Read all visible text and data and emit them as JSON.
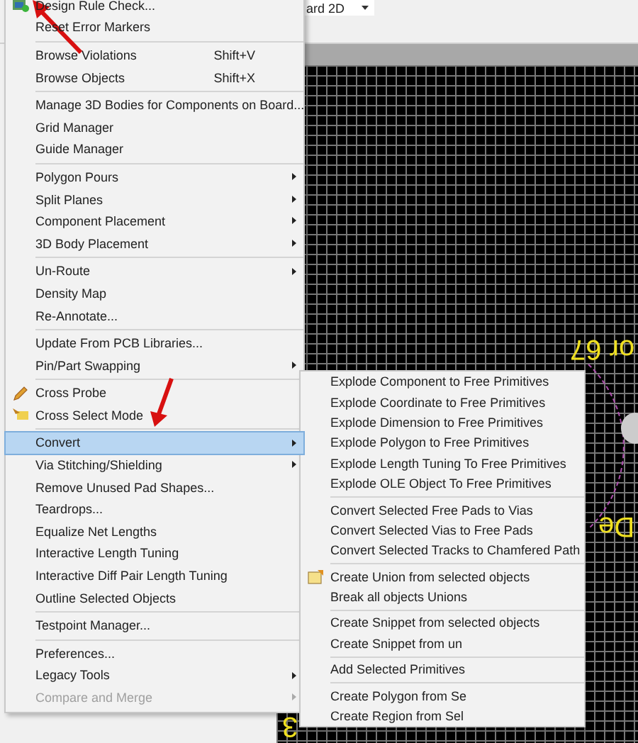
{
  "toolbar": {
    "view_dropdown": "ard 2D"
  },
  "canvas": {
    "labels": [
      {
        "text": "or 67",
        "kind": "top"
      },
      {
        "text": "De",
        "kind": "mid"
      },
      {
        "text": "3",
        "kind": "bottom"
      }
    ]
  },
  "menu": {
    "groups": [
      [
        {
          "label": "Design Rule Check...",
          "submenu": false,
          "selected": false,
          "disabled": false
        },
        {
          "label": "Reset Error Markers",
          "submenu": false,
          "selected": false,
          "disabled": false
        }
      ],
      [
        {
          "label": "Browse Violations",
          "shortcut": "Shift+V",
          "submenu": false,
          "selected": false,
          "disabled": false
        },
        {
          "label": "Browse Objects",
          "shortcut": "Shift+X",
          "submenu": false,
          "selected": false,
          "disabled": false
        }
      ],
      [
        {
          "label": "Manage 3D Bodies for Components on Board...",
          "submenu": false,
          "selected": false,
          "disabled": false
        },
        {
          "label": "Grid Manager",
          "submenu": false,
          "selected": false,
          "disabled": false
        },
        {
          "label": "Guide Manager",
          "submenu": false,
          "selected": false,
          "disabled": false
        }
      ],
      [
        {
          "label": "Polygon Pours",
          "submenu": true,
          "selected": false,
          "disabled": false
        },
        {
          "label": "Split Planes",
          "submenu": true,
          "selected": false,
          "disabled": false
        },
        {
          "label": "Component Placement",
          "submenu": true,
          "selected": false,
          "disabled": false
        },
        {
          "label": "3D Body Placement",
          "submenu": true,
          "selected": false,
          "disabled": false
        }
      ],
      [
        {
          "label": "Un-Route",
          "submenu": true,
          "selected": false,
          "disabled": false
        },
        {
          "label": "Density Map",
          "submenu": false,
          "selected": false,
          "disabled": false
        },
        {
          "label": "Re-Annotate...",
          "submenu": false,
          "selected": false,
          "disabled": false
        }
      ],
      [
        {
          "label": "Update From PCB Libraries...",
          "submenu": false,
          "selected": false,
          "disabled": false
        },
        {
          "label": "Pin/Part Swapping",
          "submenu": true,
          "selected": false,
          "disabled": false
        }
      ],
      [
        {
          "label": "Cross Probe",
          "submenu": false,
          "selected": false,
          "disabled": false
        },
        {
          "label": "Cross Select Mode",
          "submenu": false,
          "selected": false,
          "disabled": false
        }
      ],
      [
        {
          "label": "Convert",
          "submenu": true,
          "selected": true,
          "disabled": false
        },
        {
          "label": "Via Stitching/Shielding",
          "submenu": true,
          "selected": false,
          "disabled": false
        },
        {
          "label": "Remove Unused Pad Shapes...",
          "submenu": false,
          "selected": false,
          "disabled": false
        },
        {
          "label": "Teardrops...",
          "submenu": false,
          "selected": false,
          "disabled": false
        },
        {
          "label": "Equalize Net Lengths",
          "submenu": false,
          "selected": false,
          "disabled": false
        },
        {
          "label": "Interactive Length Tuning",
          "submenu": false,
          "selected": false,
          "disabled": false
        },
        {
          "label": "Interactive Diff Pair Length Tuning",
          "submenu": false,
          "selected": false,
          "disabled": false
        },
        {
          "label": "Outline Selected Objects",
          "submenu": false,
          "selected": false,
          "disabled": false
        }
      ],
      [
        {
          "label": "Testpoint Manager...",
          "submenu": false,
          "selected": false,
          "disabled": false
        }
      ],
      [
        {
          "label": "Preferences...",
          "submenu": false,
          "selected": false,
          "disabled": false
        },
        {
          "label": "Legacy Tools",
          "submenu": true,
          "selected": false,
          "disabled": false
        },
        {
          "label": "Compare and Merge",
          "submenu": true,
          "selected": false,
          "disabled": true
        }
      ]
    ]
  },
  "submenu": {
    "groups": [
      [
        {
          "label": "Explode Component to Free Primitives"
        },
        {
          "label": "Explode Coordinate to Free Primitives"
        },
        {
          "label": "Explode Dimension to Free Primitives"
        },
        {
          "label": "Explode Polygon to Free Primitives"
        },
        {
          "label": "Explode Length Tuning To Free Primitives"
        },
        {
          "label": "Explode OLE Object To Free Primitives"
        }
      ],
      [
        {
          "label": "Convert Selected Free Pads to Vias"
        },
        {
          "label": "Convert Selected Vias to Free Pads"
        },
        {
          "label": "Convert Selected Tracks to Chamfered Path"
        }
      ],
      [
        {
          "label": "Create Union from selected objects"
        },
        {
          "label": "Break all objects Unions"
        }
      ],
      [
        {
          "label": "Create Snippet from selected objects"
        },
        {
          "label": "Create Snippet from un"
        }
      ],
      [
        {
          "label": "Add Selected Primitives"
        }
      ],
      [
        {
          "label": "Create Polygon from Se"
        },
        {
          "label": "Create Region from Sel"
        }
      ]
    ]
  }
}
